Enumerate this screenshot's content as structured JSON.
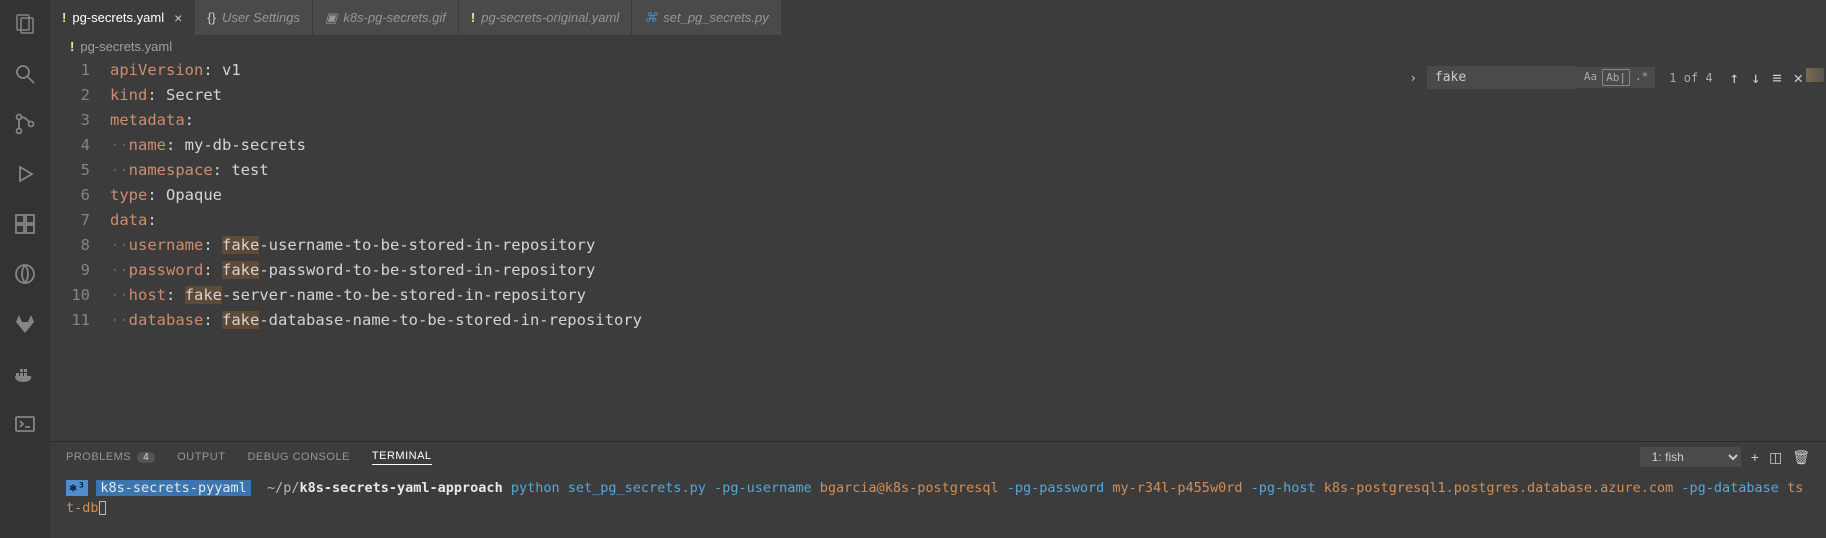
{
  "activitybar": {
    "items": [
      "explorer",
      "search",
      "scm",
      "debug",
      "extensions",
      "live-share",
      "gitlab",
      "docker",
      "terminal"
    ]
  },
  "tabs": [
    {
      "label": "pg-secrets.yaml",
      "icon": "!",
      "active": true,
      "close": true
    },
    {
      "label": "User Settings",
      "icon": "{}",
      "active": false
    },
    {
      "label": "k8s-pg-secrets.gif",
      "icon": "img",
      "active": false
    },
    {
      "label": "pg-secrets-original.yaml",
      "icon": "!",
      "active": false
    },
    {
      "label": "set_pg_secrets.py",
      "icon": "py",
      "active": false
    }
  ],
  "breadcrumb": {
    "icon": "!",
    "text": "pg-secrets.yaml"
  },
  "code": {
    "lines": [
      {
        "n": "1",
        "segs": [
          {
            "t": "apiVersion",
            "c": "tok-key"
          },
          {
            "t": ":",
            "c": "tok-punc"
          },
          {
            "t": " v1",
            "c": "tok-val"
          }
        ]
      },
      {
        "n": "2",
        "segs": [
          {
            "t": "kind",
            "c": "tok-key"
          },
          {
            "t": ":",
            "c": "tok-punc"
          },
          {
            "t": " Secret",
            "c": "tok-val"
          }
        ]
      },
      {
        "n": "3",
        "segs": [
          {
            "t": "metadata",
            "c": "tok-key"
          },
          {
            "t": ":",
            "c": "tok-punc"
          }
        ]
      },
      {
        "n": "4",
        "segs": [
          {
            "t": "··",
            "c": "indent-dot"
          },
          {
            "t": "name",
            "c": "tok-key"
          },
          {
            "t": ":",
            "c": "tok-punc"
          },
          {
            "t": " my-db-secrets",
            "c": "tok-val"
          }
        ]
      },
      {
        "n": "5",
        "segs": [
          {
            "t": "··",
            "c": "indent-dot"
          },
          {
            "t": "namespace",
            "c": "tok-key"
          },
          {
            "t": ":",
            "c": "tok-punc"
          },
          {
            "t": " test",
            "c": "tok-val"
          }
        ]
      },
      {
        "n": "6",
        "segs": [
          {
            "t": "type",
            "c": "tok-key"
          },
          {
            "t": ":",
            "c": "tok-punc"
          },
          {
            "t": " Opaque",
            "c": "tok-val"
          }
        ]
      },
      {
        "n": "7",
        "segs": [
          {
            "t": "data",
            "c": "tok-key"
          },
          {
            "t": ":",
            "c": "tok-punc"
          }
        ]
      },
      {
        "n": "8",
        "segs": [
          {
            "t": "··",
            "c": "indent-dot"
          },
          {
            "t": "username",
            "c": "tok-key"
          },
          {
            "t": ":",
            "c": "tok-punc"
          },
          {
            "t": " ",
            "c": "tok-val"
          },
          {
            "t": "fake",
            "c": "tok-val tok-hl"
          },
          {
            "t": "-username-to-be-stored-in-repository",
            "c": "tok-val"
          }
        ]
      },
      {
        "n": "9",
        "segs": [
          {
            "t": "··",
            "c": "indent-dot"
          },
          {
            "t": "password",
            "c": "tok-key"
          },
          {
            "t": ":",
            "c": "tok-punc"
          },
          {
            "t": " ",
            "c": "tok-val"
          },
          {
            "t": "fake",
            "c": "tok-val tok-hl"
          },
          {
            "t": "-password-to-be-stored-in-repository",
            "c": "tok-val"
          }
        ]
      },
      {
        "n": "10",
        "segs": [
          {
            "t": "··",
            "c": "indent-dot"
          },
          {
            "t": "host",
            "c": "tok-key"
          },
          {
            "t": ":",
            "c": "tok-punc"
          },
          {
            "t": " ",
            "c": "tok-val"
          },
          {
            "t": "fake",
            "c": "tok-val tok-hl"
          },
          {
            "t": "-server-name-to-be-stored-in-repository",
            "c": "tok-val"
          }
        ]
      },
      {
        "n": "11",
        "segs": [
          {
            "t": "··",
            "c": "indent-dot"
          },
          {
            "t": "database",
            "c": "tok-key"
          },
          {
            "t": ":",
            "c": "tok-punc"
          },
          {
            "t": " ",
            "c": "tok-val"
          },
          {
            "t": "fake",
            "c": "tok-val tok-hl"
          },
          {
            "t": "-database-name-to-be-stored-in-repository",
            "c": "tok-val"
          }
        ]
      }
    ]
  },
  "find": {
    "value": "fake",
    "count": "1 of 4",
    "opt_case": "Aa",
    "opt_word": "Ab|",
    "opt_regex": ".*"
  },
  "panel": {
    "tabs": [
      {
        "label": "PROBLEMS",
        "badge": "4"
      },
      {
        "label": "OUTPUT"
      },
      {
        "label": "DEBUG CONSOLE"
      },
      {
        "label": "TERMINAL",
        "active": true
      }
    ],
    "termSelect": "1: fish"
  },
  "terminal": {
    "badge": "⎈³",
    "env": "k8s-secrets-pyyaml",
    "path_prefix": " ~/p/",
    "path_bold": "k8s-secrets-yaml-approach",
    "cmd": "python",
    "script": "set_pg_secrets.py",
    "args": [
      {
        "flag": "-pg-username",
        "val": "bgarcia@k8s-postgresql"
      },
      {
        "flag": "-pg-password",
        "val": "my-r34l-p455w0rd"
      },
      {
        "flag": "-pg-host",
        "val": "k8s-postgresql1.postgres.database.azure.com"
      },
      {
        "flag": "-pg-database",
        "val": "tst-db"
      }
    ]
  }
}
